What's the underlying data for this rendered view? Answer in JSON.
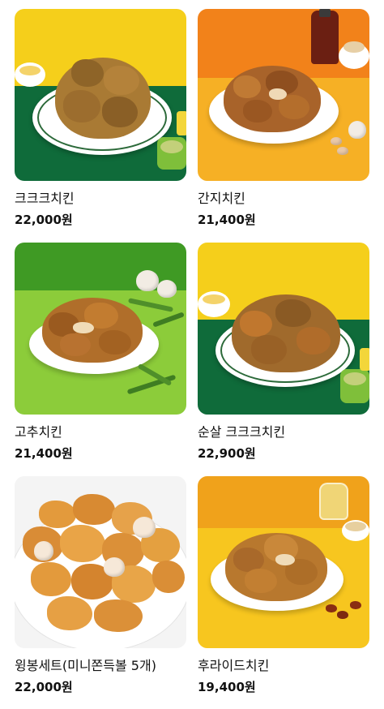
{
  "products": [
    {
      "name": "크크크치킨",
      "price": "22,000원",
      "image": "crunchy-chicken-photo"
    },
    {
      "name": "간지치킨",
      "price": "21,400원",
      "image": "ganji-chicken-photo"
    },
    {
      "name": "고추치킨",
      "price": "21,400원",
      "image": "pepper-chicken-photo"
    },
    {
      "name": "순살 크크크치킨",
      "price": "22,900원",
      "image": "boneless-crunchy-chicken-photo"
    },
    {
      "name": "윙봉세트(미니쫀득볼 5개)",
      "price": "22,000원",
      "image": "wing-set-photo"
    },
    {
      "name": "후라이드치킨",
      "price": "19,400원",
      "image": "fried-chicken-photo"
    }
  ],
  "colors": {
    "yellow": "#f5cf1b",
    "green_dark": "#0f6b3a",
    "orange": "#f39a1d",
    "lime": "#7fbf2a",
    "fried": "#c88a3c"
  }
}
